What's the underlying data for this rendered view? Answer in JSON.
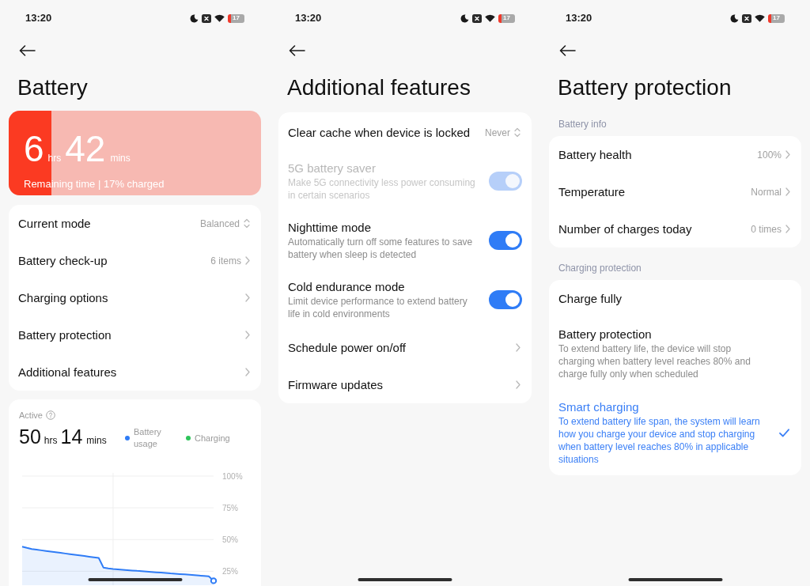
{
  "screens": [
    {
      "kind": "battery",
      "status_bar": {
        "time": "13:20",
        "battery": "17"
      },
      "title": "Battery",
      "remaining": {
        "hours": "6",
        "hours_unit": "hrs",
        "minutes": "42",
        "minutes_unit": "mins",
        "caption": "Remaining time | 17% charged",
        "level": 0.17
      },
      "menu": [
        {
          "kind": "select",
          "label": "Current mode",
          "value": "Balanced"
        },
        {
          "kind": "link",
          "label": "Battery check-up",
          "value": "6 items"
        },
        {
          "kind": "link",
          "label": "Charging options"
        },
        {
          "kind": "link",
          "label": "Battery protection"
        },
        {
          "kind": "link",
          "label": "Additional features"
        }
      ],
      "usage": {
        "label": "Active",
        "hours": "50",
        "hours_unit": "hrs",
        "minutes": "14",
        "minutes_unit": "mins",
        "legend": [
          {
            "label": "Battery usage",
            "color": "#2f7cf6"
          },
          {
            "label": "Charging",
            "color": "#2ec45a"
          }
        ],
        "chart_data": {
          "type": "area",
          "grid": true,
          "ylim": [
            14,
            100
          ],
          "yticks": [
            {
              "value": 100,
              "label": "100%"
            },
            {
              "value": 75,
              "label": "75%"
            },
            {
              "value": 50,
              "label": "50%"
            },
            {
              "value": 25,
              "label": "25%"
            }
          ],
          "values": [
            44.4,
            43.4,
            42.5,
            42,
            41.5,
            41,
            40.5,
            40,
            39.5,
            39,
            38.5,
            38,
            37.5,
            37,
            36.5,
            36,
            35.5,
            27.8,
            27.2,
            26.8,
            26.5,
            26.2,
            25.9,
            25.6,
            25.3,
            25.1,
            24.8,
            24.5,
            24.2,
            23.9,
            23.6,
            23.3,
            23.1,
            22.8,
            22.5,
            22.2,
            21.9,
            21.6,
            21.3,
            21,
            17.5
          ]
        }
      }
    },
    {
      "kind": "features",
      "status_bar": {
        "time": "13:20",
        "battery": "17"
      },
      "title": "Additional features",
      "items": [
        {
          "kind": "select",
          "label": "Clear cache when device is locked",
          "value": "Never"
        },
        {
          "kind": "toggle",
          "label": "5G battery saver",
          "description": "Make 5G connectivity less power consuming in certain scenarios",
          "on": true,
          "disabled": true
        },
        {
          "kind": "toggle",
          "label": "Nighttime mode",
          "description": "Automatically turn off some features to save battery when sleep is detected",
          "on": true,
          "disabled": false
        },
        {
          "kind": "toggle",
          "label": "Cold endurance mode",
          "description": "Limit device performance to extend battery life in cold environments",
          "on": true,
          "disabled": false
        },
        {
          "kind": "link",
          "label": "Schedule power on/off"
        },
        {
          "kind": "link",
          "label": "Firmware updates"
        }
      ]
    },
    {
      "kind": "protection",
      "status_bar": {
        "time": "13:20",
        "battery": "17"
      },
      "title": "Battery protection",
      "sections": [
        {
          "kind": "info",
          "heading": "Battery info",
          "items": [
            {
              "kind": "link",
              "label": "Battery health",
              "value": "100%"
            },
            {
              "kind": "link",
              "label": "Temperature",
              "value": "Normal"
            },
            {
              "kind": "link",
              "label": "Number of charges today",
              "value": "0 times"
            }
          ]
        },
        {
          "kind": "options",
          "heading": "Charging protection",
          "items": [
            {
              "label": "Charge fully",
              "selected": false
            },
            {
              "label": "Battery protection",
              "description": "To extend battery life, the device will stop charging when battery level reaches 80% and charge fully only when scheduled",
              "selected": false
            },
            {
              "label": "Smart charging",
              "description": "To extend battery life span, the system will learn how you charge your device and stop charging when battery level reaches 80% in applicable situations",
              "selected": true
            }
          ]
        }
      ]
    }
  ]
}
